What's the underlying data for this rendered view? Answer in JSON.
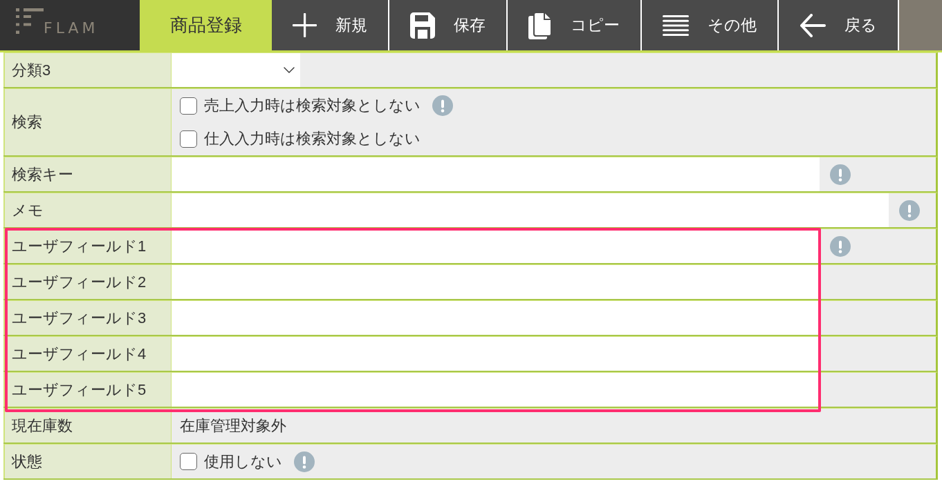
{
  "header": {
    "logo": {
      "text": "FLAM"
    },
    "title_tab": {
      "label": "商品登録",
      "selected": true
    },
    "toolbar": [
      {
        "kind": "new",
        "label": "新規"
      },
      {
        "kind": "save",
        "label": "保存"
      },
      {
        "kind": "copy",
        "label": "コピー"
      },
      {
        "kind": "menu",
        "label": "その他"
      },
      {
        "kind": "back",
        "label": "戻る"
      }
    ]
  },
  "form": {
    "rows": [
      {
        "label": "分類3",
        "kind": "select",
        "help": false,
        "highlighted": false
      },
      {
        "label": "検索",
        "kind": "checkboxes",
        "help": false,
        "highlighted": false,
        "options": [
          {
            "label": "売上入力時は検索対象としない",
            "checked": false,
            "help": true
          },
          {
            "label": "仕入入力時は検索対象としない",
            "checked": false,
            "help": false
          }
        ]
      },
      {
        "label": "検索キー",
        "kind": "input",
        "help": true,
        "highlighted": false
      },
      {
        "label": "メモ",
        "kind": "textarea",
        "help": true,
        "highlighted": false
      },
      {
        "label": "ユーザフィールド1",
        "kind": "input",
        "help": true,
        "highlighted": true
      },
      {
        "label": "ユーザフィールド2",
        "kind": "input",
        "help": false,
        "highlighted": true
      },
      {
        "label": "ユーザフィールド3",
        "kind": "input",
        "help": false,
        "highlighted": true
      },
      {
        "label": "ユーザフィールド4",
        "kind": "input",
        "help": false,
        "highlighted": true
      },
      {
        "label": "ユーザフィールド5",
        "kind": "input",
        "help": false,
        "highlighted": true
      },
      {
        "label": "現在庫数",
        "kind": "text",
        "value": "在庫管理対象外",
        "help": false,
        "highlighted": false
      },
      {
        "label": "状態",
        "kind": "checkboxes",
        "help": false,
        "highlighted": false,
        "options": [
          {
            "label": "使用しない",
            "checked": false,
            "help": true
          }
        ]
      }
    ]
  }
}
